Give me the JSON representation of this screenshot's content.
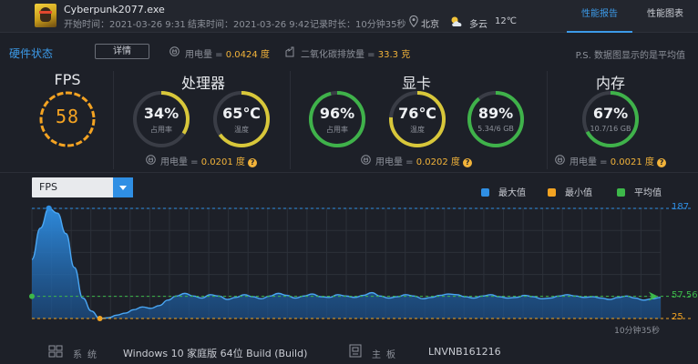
{
  "header": {
    "app_name": "Cyberpunk2077.exe",
    "start_time": "开始时间：2021-03-26 9:31",
    "end_time": "结束时间：2021-03-26 9:42",
    "duration": "记录时长：10分钟35秒",
    "location": "北京",
    "weather": "多云",
    "temperature": "12℃",
    "tabs": [
      {
        "label": "性能报告",
        "active": true
      },
      {
        "label": "性能图表",
        "active": false
      }
    ]
  },
  "status": {
    "title": "硬件状态",
    "detail_button": "详情",
    "energy_prefix": "用电量 = ",
    "energy_value": "0.0424 度",
    "co2_prefix": "二氧化碳排放量 = ",
    "co2_value": "33.3 克",
    "ps_note": "P.S. 数据图显示的是平均值"
  },
  "gauges": {
    "fps": {
      "title": "FPS",
      "value": "58"
    },
    "cpu": {
      "title": "处理器",
      "usage": {
        "value": "34%",
        "label": "占用率",
        "fraction": 0.34
      },
      "temp": {
        "value": "65℃",
        "label": "温度",
        "fraction": 0.65
      },
      "energy_prefix": "用电量 = ",
      "energy_value": "0.0201 度"
    },
    "gpu": {
      "title": "显卡",
      "usage": {
        "value": "96%",
        "label": "占用率",
        "fraction": 0.96
      },
      "temp": {
        "value": "76℃",
        "label": "温度",
        "fraction": 0.76
      },
      "mem": {
        "value": "89%",
        "label": "5.34/6 GB",
        "fraction": 0.89
      },
      "energy_prefix": "用电量 = ",
      "energy_value": "0.0202 度"
    },
    "ram": {
      "title": "内存",
      "usage": {
        "value": "67%",
        "label": "10.7/16 GB",
        "fraction": 0.67
      },
      "energy_prefix": "用电量 = ",
      "energy_value": "0.0021 度"
    },
    "help_glyph": "?"
  },
  "chart_controls": {
    "metric": "FPS",
    "legend": [
      {
        "name": "最大值",
        "color": "#2f8fe4"
      },
      {
        "name": "最小值",
        "color": "#f2a322"
      },
      {
        "name": "平均值",
        "color": "#3db84a"
      }
    ],
    "duration_label": "10分钟35秒"
  },
  "chart_data": {
    "type": "area",
    "metric": "FPS",
    "y_max": 187,
    "y_avg": 57.56,
    "y_min": 25,
    "y_max_label": "187",
    "y_avg_label": "57.56",
    "y_min_label": "25",
    "ylim": [
      25,
      187
    ],
    "grid": true,
    "x_duration": "10分钟35秒",
    "series": [
      {
        "values": [
          112,
          158,
          187,
          180,
          150,
          100,
          55,
          36,
          25,
          26,
          30,
          33,
          38,
          42,
          40,
          44,
          52,
          58,
          62,
          58,
          55,
          60,
          58,
          53,
          56,
          60,
          57,
          54,
          58,
          62,
          59,
          55,
          58,
          61,
          57,
          56,
          60,
          58,
          56,
          59,
          63,
          58,
          55,
          57,
          60,
          58,
          54,
          56,
          59,
          61,
          60,
          57,
          55,
          58,
          60,
          57,
          55,
          56,
          59,
          57,
          54,
          55,
          58,
          60,
          58,
          56,
          57,
          55,
          53,
          56,
          58,
          55,
          52,
          54,
          56
        ]
      }
    ]
  },
  "footer": {
    "os_label": "系统",
    "os_value": "Windows 10 家庭版 64位   Build (Build)",
    "board_label": "主板",
    "board_value": "LNVNB161216"
  },
  "colors": {
    "accent": "#3c9ae8",
    "gauge_orange": "#f4a322",
    "gauge_yellow": "#d8c73a",
    "gauge_green": "#3fb24a",
    "gauge_track": "#3a3d46",
    "energy": "#f2b33a"
  }
}
